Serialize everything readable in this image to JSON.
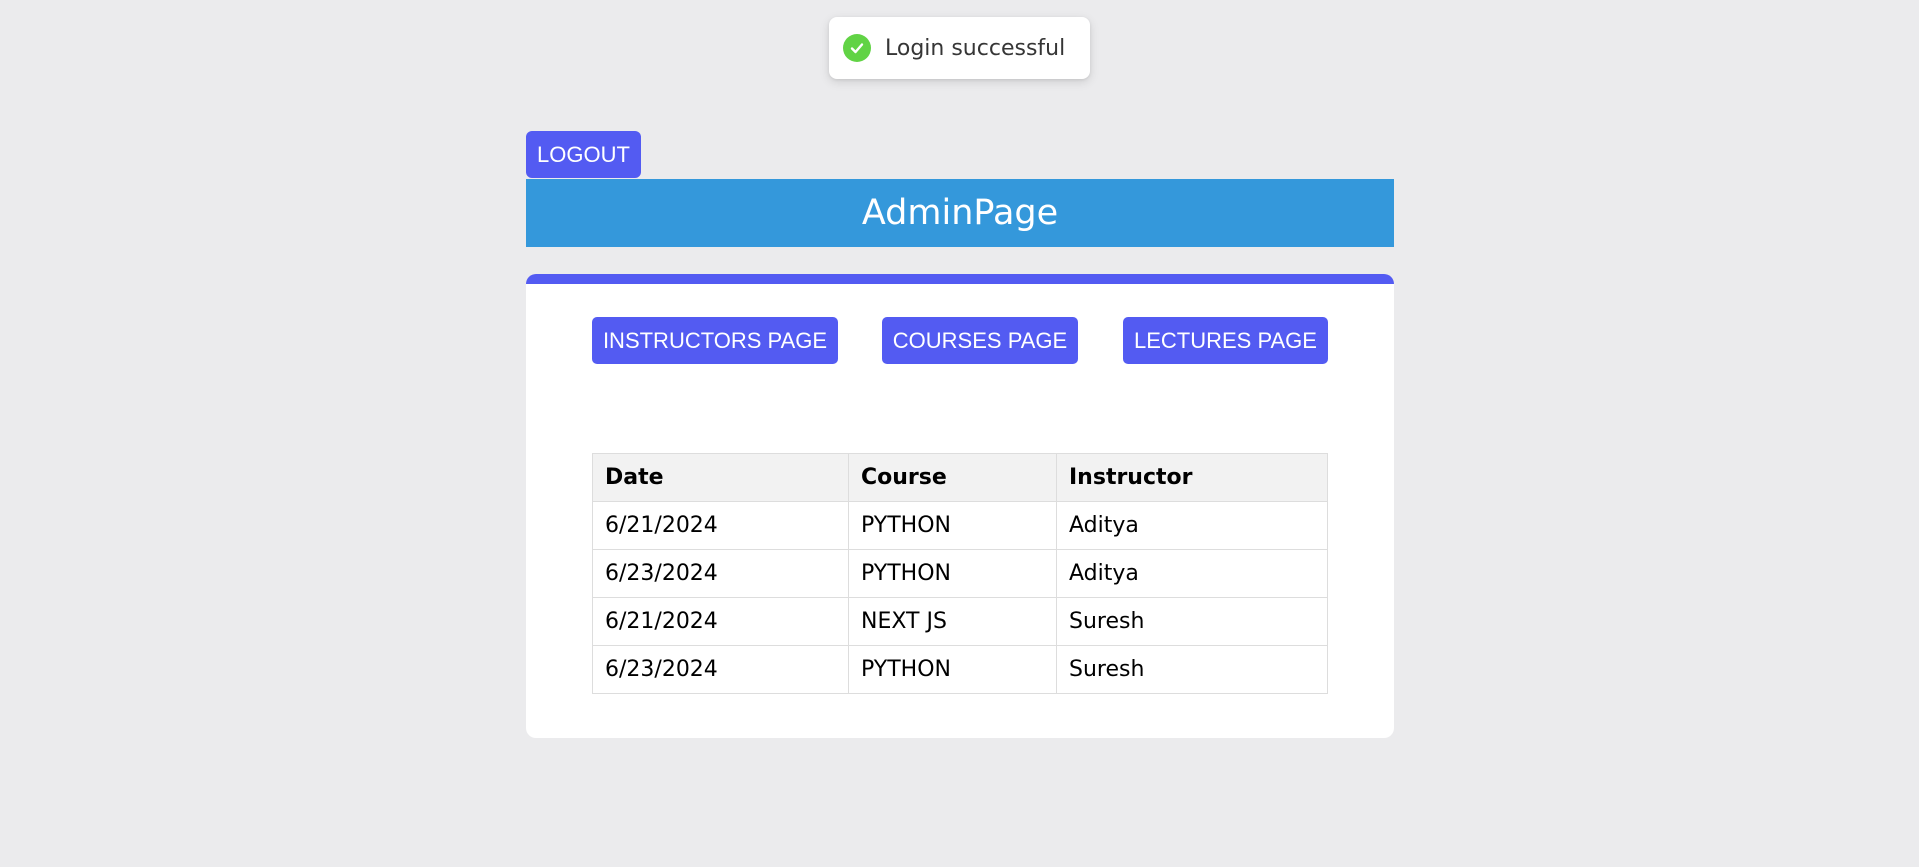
{
  "toast": {
    "message": "Login successful",
    "icon": "check-circle-icon",
    "color": "#61d345"
  },
  "logout": {
    "label": "LOGOUT"
  },
  "header": {
    "title": "AdminPage"
  },
  "nav": {
    "instructors_label": "INSTRUCTORS PAGE",
    "courses_label": "COURSES PAGE",
    "lectures_label": "LECTURES PAGE"
  },
  "table": {
    "headers": [
      "Date",
      "Course",
      "Instructor"
    ],
    "rows": [
      [
        "6/21/2024",
        "PYTHON",
        "Aditya"
      ],
      [
        "6/23/2024",
        "PYTHON",
        "Aditya"
      ],
      [
        "6/21/2024",
        "NEXT JS",
        "Suresh"
      ],
      [
        "6/23/2024",
        "PYTHON",
        "Suresh"
      ]
    ]
  },
  "colors": {
    "accent": "#535bf2",
    "header": "#3498db",
    "background": "#ebebed"
  }
}
